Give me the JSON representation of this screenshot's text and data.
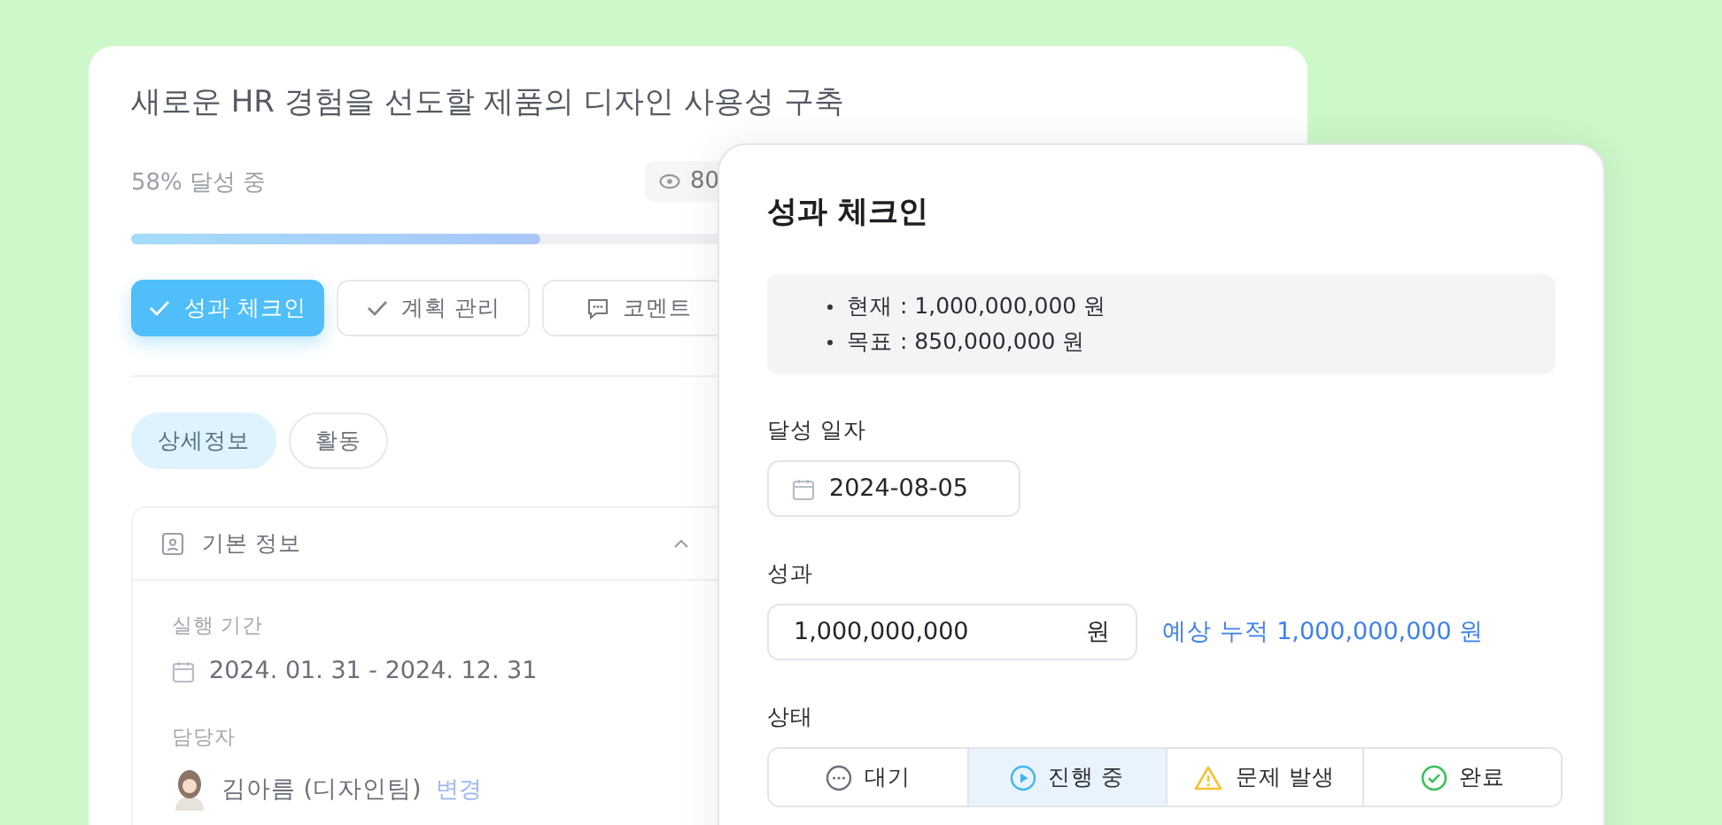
{
  "project": {
    "title": "새로운 HR 경험을 선도할 제품의 디자인 사용성 구축",
    "progress_text": "58% 달성 중",
    "level": 0.58,
    "views": "80"
  },
  "actions": [
    {
      "label": "성과 체크인",
      "kind": "check",
      "selected": true
    },
    {
      "label": "계획 관리",
      "kind": "check",
      "selected": false
    },
    {
      "label": "코멘트",
      "kind": "comment",
      "selected": false
    }
  ],
  "tabs": [
    {
      "label": "상세정보",
      "selected": true
    },
    {
      "label": "활동",
      "selected": false
    }
  ],
  "section": {
    "title": "기본 정보",
    "expanded": true,
    "period_label": "실행 기간",
    "period": "2024. 01. 31 - 2024. 12. 31",
    "owner_label": "담당자",
    "owner": "김아름 (디자인팀)",
    "change_link": "변경"
  },
  "dialog": {
    "title": "성과 체크인",
    "summary": [
      "현재 : 1,000,000,000 원",
      "목표 : 850,000,000 원"
    ],
    "date_label": "달성 일자",
    "date": "2024-08-05",
    "result_label": "성과",
    "result": "1,000,000,000",
    "unit": "원",
    "forecast": "예상 누적 1,000,000,000 원",
    "status_label": "상태",
    "statuses": [
      {
        "label": "대기",
        "kind": "waiting",
        "selected": false
      },
      {
        "label": "진행 중",
        "kind": "in_progress",
        "selected": true
      },
      {
        "label": "문제 발생",
        "kind": "issue",
        "selected": false
      },
      {
        "label": "완료",
        "kind": "done",
        "selected": false
      }
    ]
  }
}
